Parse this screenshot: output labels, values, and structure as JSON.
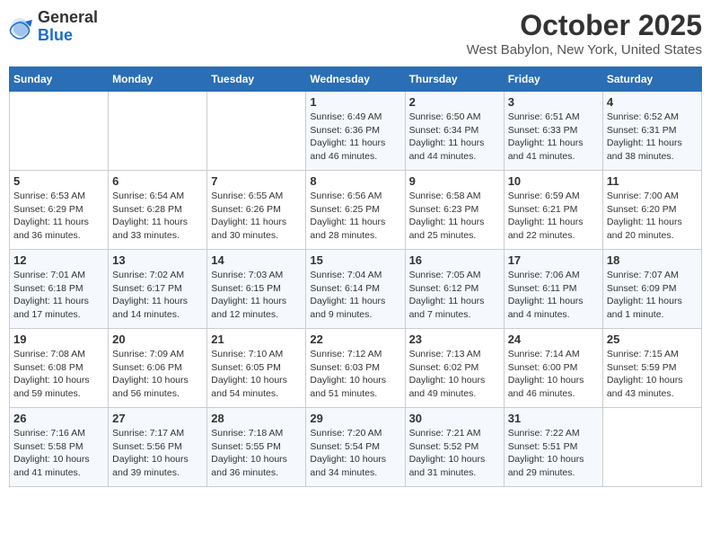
{
  "logo": {
    "general": "General",
    "blue": "Blue"
  },
  "title": "October 2025",
  "location": "West Babylon, New York, United States",
  "days_of_week": [
    "Sunday",
    "Monday",
    "Tuesday",
    "Wednesday",
    "Thursday",
    "Friday",
    "Saturday"
  ],
  "weeks": [
    [
      {
        "day": "",
        "info": ""
      },
      {
        "day": "",
        "info": ""
      },
      {
        "day": "",
        "info": ""
      },
      {
        "day": "1",
        "info": "Sunrise: 6:49 AM\nSunset: 6:36 PM\nDaylight: 11 hours and 46 minutes."
      },
      {
        "day": "2",
        "info": "Sunrise: 6:50 AM\nSunset: 6:34 PM\nDaylight: 11 hours and 44 minutes."
      },
      {
        "day": "3",
        "info": "Sunrise: 6:51 AM\nSunset: 6:33 PM\nDaylight: 11 hours and 41 minutes."
      },
      {
        "day": "4",
        "info": "Sunrise: 6:52 AM\nSunset: 6:31 PM\nDaylight: 11 hours and 38 minutes."
      }
    ],
    [
      {
        "day": "5",
        "info": "Sunrise: 6:53 AM\nSunset: 6:29 PM\nDaylight: 11 hours and 36 minutes."
      },
      {
        "day": "6",
        "info": "Sunrise: 6:54 AM\nSunset: 6:28 PM\nDaylight: 11 hours and 33 minutes."
      },
      {
        "day": "7",
        "info": "Sunrise: 6:55 AM\nSunset: 6:26 PM\nDaylight: 11 hours and 30 minutes."
      },
      {
        "day": "8",
        "info": "Sunrise: 6:56 AM\nSunset: 6:25 PM\nDaylight: 11 hours and 28 minutes."
      },
      {
        "day": "9",
        "info": "Sunrise: 6:58 AM\nSunset: 6:23 PM\nDaylight: 11 hours and 25 minutes."
      },
      {
        "day": "10",
        "info": "Sunrise: 6:59 AM\nSunset: 6:21 PM\nDaylight: 11 hours and 22 minutes."
      },
      {
        "day": "11",
        "info": "Sunrise: 7:00 AM\nSunset: 6:20 PM\nDaylight: 11 hours and 20 minutes."
      }
    ],
    [
      {
        "day": "12",
        "info": "Sunrise: 7:01 AM\nSunset: 6:18 PM\nDaylight: 11 hours and 17 minutes."
      },
      {
        "day": "13",
        "info": "Sunrise: 7:02 AM\nSunset: 6:17 PM\nDaylight: 11 hours and 14 minutes."
      },
      {
        "day": "14",
        "info": "Sunrise: 7:03 AM\nSunset: 6:15 PM\nDaylight: 11 hours and 12 minutes."
      },
      {
        "day": "15",
        "info": "Sunrise: 7:04 AM\nSunset: 6:14 PM\nDaylight: 11 hours and 9 minutes."
      },
      {
        "day": "16",
        "info": "Sunrise: 7:05 AM\nSunset: 6:12 PM\nDaylight: 11 hours and 7 minutes."
      },
      {
        "day": "17",
        "info": "Sunrise: 7:06 AM\nSunset: 6:11 PM\nDaylight: 11 hours and 4 minutes."
      },
      {
        "day": "18",
        "info": "Sunrise: 7:07 AM\nSunset: 6:09 PM\nDaylight: 11 hours and 1 minute."
      }
    ],
    [
      {
        "day": "19",
        "info": "Sunrise: 7:08 AM\nSunset: 6:08 PM\nDaylight: 10 hours and 59 minutes."
      },
      {
        "day": "20",
        "info": "Sunrise: 7:09 AM\nSunset: 6:06 PM\nDaylight: 10 hours and 56 minutes."
      },
      {
        "day": "21",
        "info": "Sunrise: 7:10 AM\nSunset: 6:05 PM\nDaylight: 10 hours and 54 minutes."
      },
      {
        "day": "22",
        "info": "Sunrise: 7:12 AM\nSunset: 6:03 PM\nDaylight: 10 hours and 51 minutes."
      },
      {
        "day": "23",
        "info": "Sunrise: 7:13 AM\nSunset: 6:02 PM\nDaylight: 10 hours and 49 minutes."
      },
      {
        "day": "24",
        "info": "Sunrise: 7:14 AM\nSunset: 6:00 PM\nDaylight: 10 hours and 46 minutes."
      },
      {
        "day": "25",
        "info": "Sunrise: 7:15 AM\nSunset: 5:59 PM\nDaylight: 10 hours and 43 minutes."
      }
    ],
    [
      {
        "day": "26",
        "info": "Sunrise: 7:16 AM\nSunset: 5:58 PM\nDaylight: 10 hours and 41 minutes."
      },
      {
        "day": "27",
        "info": "Sunrise: 7:17 AM\nSunset: 5:56 PM\nDaylight: 10 hours and 39 minutes."
      },
      {
        "day": "28",
        "info": "Sunrise: 7:18 AM\nSunset: 5:55 PM\nDaylight: 10 hours and 36 minutes."
      },
      {
        "day": "29",
        "info": "Sunrise: 7:20 AM\nSunset: 5:54 PM\nDaylight: 10 hours and 34 minutes."
      },
      {
        "day": "30",
        "info": "Sunrise: 7:21 AM\nSunset: 5:52 PM\nDaylight: 10 hours and 31 minutes."
      },
      {
        "day": "31",
        "info": "Sunrise: 7:22 AM\nSunset: 5:51 PM\nDaylight: 10 hours and 29 minutes."
      },
      {
        "day": "",
        "info": ""
      }
    ]
  ]
}
